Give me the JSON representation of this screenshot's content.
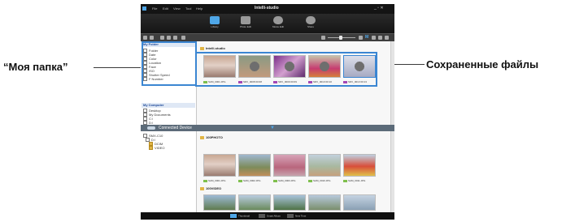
{
  "callouts": {
    "left": "“Моя папка”",
    "right": "Сохраненные файлы"
  },
  "app": {
    "brand": "Intelli-studio",
    "menu": [
      "File",
      "Edit",
      "View",
      "Tool",
      "Help"
    ],
    "window_controls": "_ ▫ ✕",
    "modes": [
      {
        "label": "Library",
        "icon": "library-icon",
        "active": true
      },
      {
        "label": "Photo Edit",
        "icon": "photo-edit-icon",
        "active": false
      },
      {
        "label": "Movie Edit",
        "icon": "movie-edit-icon",
        "active": false
      },
      {
        "label": "Share",
        "icon": "share-icon",
        "active": false
      }
    ],
    "view_label": "M"
  },
  "my_folder": {
    "header": "My Folder",
    "items": [
      "Folder",
      "Date",
      "Color",
      "Location",
      "Face",
      "ISO",
      "Shutter Speed",
      "F Number"
    ]
  },
  "my_computer": {
    "header": "My Computer",
    "items": [
      "Desktop",
      "My Documents",
      "C:\\",
      "D:\\"
    ]
  },
  "library": {
    "folder_title": "Intelli-studio",
    "files": [
      {
        "name": "SAM_0001.JPG",
        "time": "",
        "tag": "#7fbf4d"
      },
      {
        "name": "SDV_0008",
        "time": "00:08",
        "tag": "#a447b5"
      },
      {
        "name": "SDV_0009",
        "time": "00:09",
        "tag": "#a447b5"
      },
      {
        "name": "SDV_0010",
        "time": "00:10",
        "tag": "#a447b5"
      },
      {
        "name": "SDV_0013",
        "time": "00:13",
        "tag": "#a447b5"
      }
    ]
  },
  "connected": {
    "title": "Connected Device",
    "tree": [
      "SMX-C10",
      "D:\\",
      "DCIM",
      "VIDEO"
    ]
  },
  "device": {
    "photo_folder": "100PHOTO",
    "photos": [
      {
        "name": "SAM_0001.JPG",
        "tag": "#7fbf4d"
      },
      {
        "name": "SAM_0002.JPG",
        "tag": "#7fbf4d"
      },
      {
        "name": "SAM_0003.JPG",
        "tag": "#7fbf4d"
      },
      {
        "name": "SAM_0010.JPG",
        "tag": "#7fbf4d"
      },
      {
        "name": "SAM_0011.JPG",
        "tag": "#7fbf4d"
      }
    ],
    "video_folder": "100VIDEO"
  },
  "bottom": {
    "items": [
      "Thumbnail",
      "Smart Album",
      "New Time"
    ]
  },
  "colors": {
    "highlight": "#3b86d2",
    "accent": "#4fa7e8",
    "header_text": "#1f4a99"
  }
}
